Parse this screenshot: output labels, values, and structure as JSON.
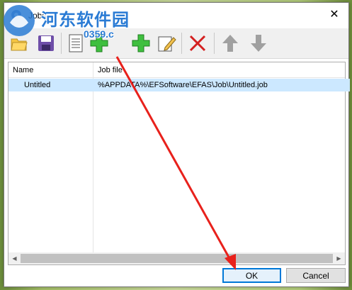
{
  "window": {
    "title": "Jobs",
    "close_label": "✕"
  },
  "watermark": {
    "text": "河东软件园",
    "url": "0359.c"
  },
  "toolbar": {
    "buttons": [
      "folder-icon",
      "save-icon",
      "new-list-icon",
      "add-copy-icon",
      "add-icon",
      "edit-icon",
      "delete-icon",
      "move-up-icon",
      "move-down-icon"
    ]
  },
  "list": {
    "columns": [
      "Name",
      "Job file"
    ],
    "rows": [
      {
        "name": "Untitled",
        "job_file": "%APPDATA%\\EFSoftware\\EFAS\\Job\\Untitled.job"
      }
    ]
  },
  "buttons": {
    "ok": "OK",
    "cancel": "Cancel"
  },
  "colors": {
    "selection": "#cce8ff",
    "accent": "#0078d7",
    "annotation_arrow": "#e8211c",
    "watermark": "#2a7bd4"
  }
}
